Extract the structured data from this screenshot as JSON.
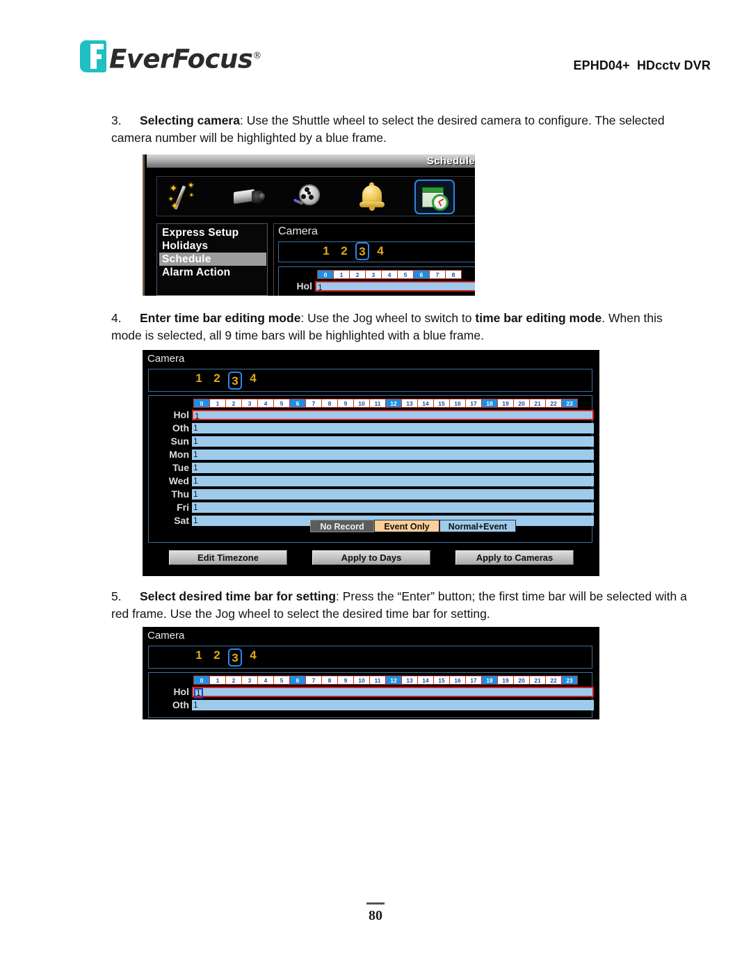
{
  "header": {
    "logo_text": "EverFocus",
    "logo_registered": "®",
    "model": "EPHD04+  HDcctv DVR"
  },
  "steps": [
    {
      "number": "3.",
      "bold_lead": "Selecting camera",
      "text": ": Use the Shuttle wheel to select the desired camera to configure. The selected camera number will be highlighted by a blue frame."
    },
    {
      "number": "4.",
      "bold_lead": "Enter time bar editing mode",
      "text_a": ": Use the Jog wheel to switch to ",
      "bold_mid": "time bar editing mode",
      "text_b": ". When this mode is selected, all 9 time bars will be highlighted with a blue frame."
    },
    {
      "number": "5.",
      "bold_lead": "Select desired time bar for setting",
      "text": ": Press the “Enter” button; the first time bar will be selected with a red frame. Use the Jog wheel to select the desired time bar for setting."
    }
  ],
  "shot1": {
    "title": "Schedule",
    "icons": [
      {
        "name": "express-setup-icon",
        "selected": false
      },
      {
        "name": "camera-icon",
        "selected": false
      },
      {
        "name": "record-icon",
        "selected": false
      },
      {
        "name": "alarm-bell-icon",
        "selected": false
      },
      {
        "name": "schedule-calendar-clock-icon",
        "selected": true
      }
    ],
    "menu_items": [
      {
        "label": "Express Setup",
        "active": false
      },
      {
        "label": "Holidays",
        "active": false
      },
      {
        "label": "Schedule",
        "active": true
      },
      {
        "label": "Alarm Action",
        "active": false
      }
    ],
    "camera_label": "Camera",
    "camera_numbers": [
      "1",
      "2",
      "3",
      "4"
    ],
    "camera_selected": "3",
    "hours": [
      "0",
      "1",
      "2",
      "3",
      "4",
      "5",
      "6",
      "7",
      "8"
    ],
    "hours_highlighted": [
      "0",
      "6"
    ],
    "rows": [
      {
        "label": "Hol",
        "value": "1"
      }
    ]
  },
  "shot2": {
    "camera_label": "Camera",
    "camera_numbers": [
      "1",
      "2",
      "3",
      "4"
    ],
    "camera_selected": "3",
    "hours": [
      "0",
      "1",
      "2",
      "3",
      "4",
      "5",
      "6",
      "7",
      "8",
      "9",
      "10",
      "11",
      "12",
      "13",
      "14",
      "15",
      "16",
      "17",
      "18",
      "19",
      "20",
      "21",
      "22",
      "23"
    ],
    "hours_highlighted": [
      "0",
      "6",
      "12",
      "18",
      "23"
    ],
    "rows": [
      {
        "label": "Hol",
        "value": "1",
        "red_frame": true
      },
      {
        "label": "Oth",
        "value": "1",
        "red_frame": false
      },
      {
        "label": "Sun",
        "value": "1",
        "red_frame": false
      },
      {
        "label": "Mon",
        "value": "1",
        "red_frame": false
      },
      {
        "label": "Tue",
        "value": "1",
        "red_frame": false
      },
      {
        "label": "Wed",
        "value": "1",
        "red_frame": false
      },
      {
        "label": "Thu",
        "value": "1",
        "red_frame": false
      },
      {
        "label": "Fri",
        "value": "1",
        "red_frame": false
      },
      {
        "label": "Sat",
        "value": "1",
        "red_frame": false
      }
    ],
    "legend": [
      {
        "label": "No Record",
        "style": "norec",
        "color": "#5c5c5c"
      },
      {
        "label": "Event Only",
        "style": "evt",
        "color": "#fbcf9a"
      },
      {
        "label": "Normal+Event",
        "style": "nev",
        "color": "#9ecbec"
      }
    ],
    "buttons": [
      "Edit Timezone",
      "Apply to Days",
      "Apply to Cameras"
    ]
  },
  "shot3": {
    "camera_label": "Camera",
    "camera_numbers": [
      "1",
      "2",
      "3",
      "4"
    ],
    "camera_selected": "3",
    "hours": [
      "0",
      "1",
      "2",
      "3",
      "4",
      "5",
      "6",
      "7",
      "8",
      "9",
      "10",
      "11",
      "12",
      "13",
      "14",
      "15",
      "16",
      "17",
      "18",
      "19",
      "20",
      "21",
      "22",
      "23"
    ],
    "hours_highlighted": [
      "0",
      "6",
      "12",
      "18",
      "23"
    ],
    "rows": [
      {
        "label": "Hol",
        "value": "1",
        "red_frame": true,
        "digit_boxed": true
      },
      {
        "label": "Oth",
        "value": "1",
        "red_frame": false,
        "digit_boxed": false
      }
    ]
  },
  "footer": {
    "page_number": "80"
  },
  "colors": {
    "brand_teal": "#1fbfc4",
    "bar_blue": "#9ecbec",
    "hour_highlight": "#1e8fe0",
    "red_frame": "#d81f16",
    "blue_frame": "#2f86e8",
    "event_only": "#fbcf9a",
    "no_record": "#5c5c5c",
    "camera_number": "#e0a81c"
  }
}
